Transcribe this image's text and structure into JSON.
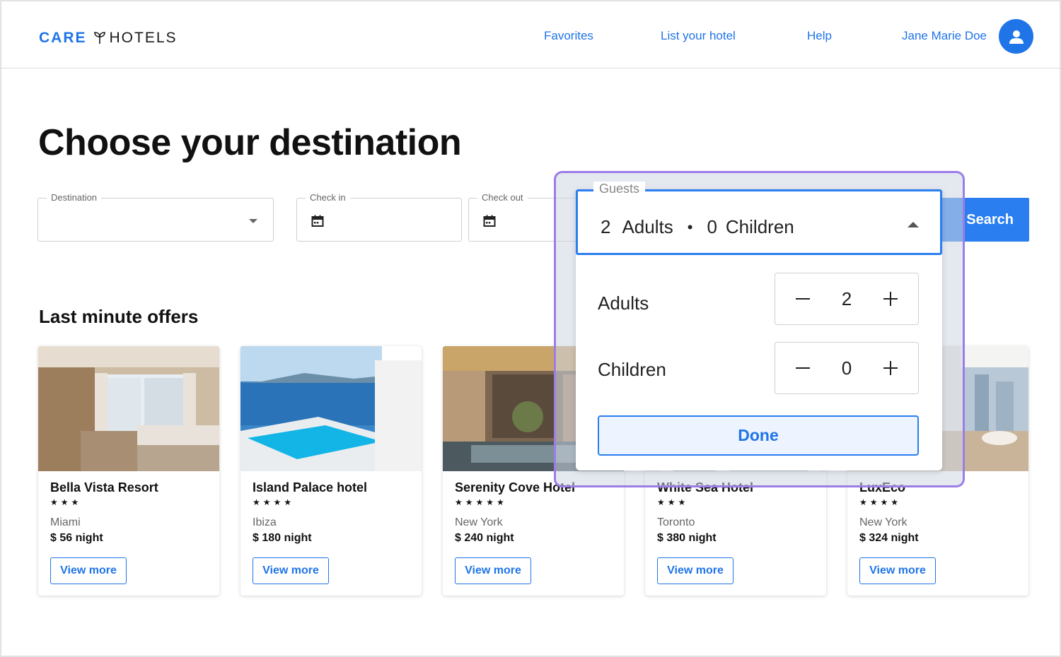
{
  "header": {
    "logo_care": "CARE",
    "logo_hotels": "HOTELS",
    "nav": [
      "Favorites",
      "List your hotel",
      "Help",
      "Jane Marie Doe"
    ],
    "accent": "#1f74e8"
  },
  "hero": {
    "title": "Choose your destination"
  },
  "search": {
    "destination_label": "Destination",
    "destination_value": "",
    "checkin_label": "Check in",
    "checkout_label": "Check out",
    "search_label": "Search"
  },
  "offers": {
    "title": "Last minute offers",
    "button_label": "View more",
    "cards": [
      {
        "name": "Bella Vista Resort",
        "stars": "★★★",
        "city": "Miami",
        "price": "$ 56 night"
      },
      {
        "name": "Island Palace hotel",
        "stars": "★★★★",
        "city": "Ibiza",
        "price": "$ 180 night"
      },
      {
        "name": "Serenity Cove Hotel",
        "stars": "★★★★★",
        "city": "New York",
        "price": "$ 240 night"
      },
      {
        "name": "White Sea Hotel",
        "stars": "★★★",
        "city": "Toronto",
        "price": "$ 380 night"
      },
      {
        "name": "LuxEco",
        "stars": "★★★★",
        "city": "New York",
        "price": "$ 324 night"
      }
    ]
  },
  "guests": {
    "label": "Guests",
    "adults_count": "2",
    "adults_word": "Adults",
    "children_count": "0",
    "children_word": "Children",
    "adults_row_label": "Adults",
    "children_row_label": "Children",
    "adults_value": "2",
    "children_value": "0",
    "done_label": "Done",
    "popup_border_color": "#9b7de8"
  }
}
